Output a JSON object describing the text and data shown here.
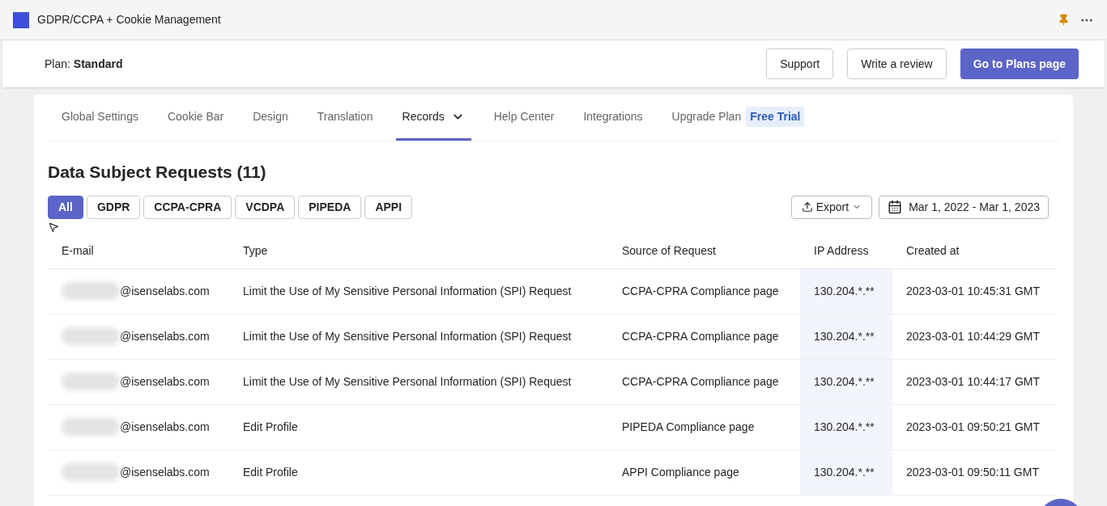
{
  "app_bar": {
    "title": "GDPR/CCPA + Cookie Management"
  },
  "header": {
    "plan_label": "Plan:",
    "plan_name": "Standard",
    "buttons": [
      {
        "label": "Support",
        "kind": "outline"
      },
      {
        "label": "Write a review",
        "kind": "outline"
      },
      {
        "label": "Go to Plans page",
        "kind": "primary"
      }
    ]
  },
  "tabs": [
    {
      "label": "Global Settings",
      "selected": false
    },
    {
      "label": "Cookie Bar",
      "selected": false
    },
    {
      "label": "Design",
      "selected": false
    },
    {
      "label": "Translation",
      "selected": false
    },
    {
      "label": "Records",
      "selected": true,
      "dropdown": true
    },
    {
      "label": "Help Center",
      "selected": false
    },
    {
      "label": "Integrations",
      "selected": false
    },
    {
      "label": "Upgrade Plan",
      "selected": false,
      "badge": "Free Trial"
    }
  ],
  "section_title": "Data Subject Requests (11)",
  "filters": [
    {
      "label": "All",
      "selected": true
    },
    {
      "label": "GDPR",
      "selected": false
    },
    {
      "label": "CCPA-CPRA",
      "selected": false
    },
    {
      "label": "VCDPA",
      "selected": false
    },
    {
      "label": "PIPEDA",
      "selected": false
    },
    {
      "label": "APPI",
      "selected": false
    }
  ],
  "export_button": "Export",
  "date_range": "Mar 1, 2022 - Mar 1, 2023",
  "table": {
    "columns": [
      "E-mail",
      "Type",
      "Source of Request",
      "IP Address",
      "Created at"
    ],
    "rows": [
      [
        "@isenselabs.com",
        "Limit the Use of My Sensitive Personal Information (SPI) Request",
        "CCPA-CPRA Compliance page",
        "130.204.*.**",
        "2023-03-01 10:45:31 GMT"
      ],
      [
        "@isenselabs.com",
        "Limit the Use of My Sensitive Personal Information (SPI) Request",
        "CCPA-CPRA Compliance page",
        "130.204.*.**",
        "2023-03-01 10:44:29 GMT"
      ],
      [
        "@isenselabs.com",
        "Limit the Use of My Sensitive Personal Information (SPI) Request",
        "CCPA-CPRA Compliance page",
        "130.204.*.**",
        "2023-03-01 10:44:17 GMT"
      ],
      [
        "@isenselabs.com",
        "Edit Profile",
        "PIPEDA Compliance page",
        "130.204.*.**",
        "2023-03-01 09:50:21 GMT"
      ],
      [
        "@isenselabs.com",
        "Edit Profile",
        "APPI Compliance page",
        "130.204.*.**",
        "2023-03-01 09:50:11 GMT"
      ]
    ]
  }
}
